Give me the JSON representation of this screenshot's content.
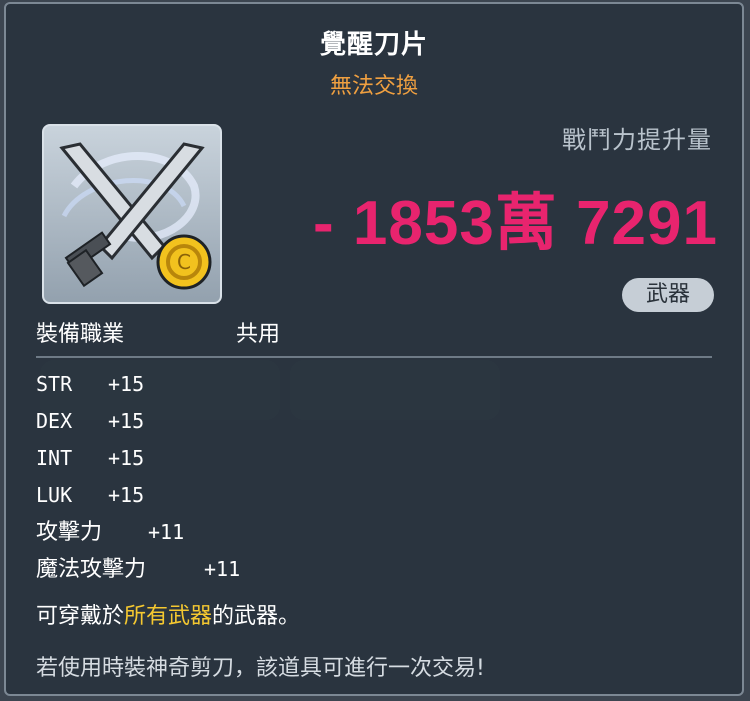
{
  "item": {
    "name": "覺醒刀片",
    "trade_status": "無法交換"
  },
  "combat_power": {
    "label": "戰鬥力提升量",
    "value": "- 1853萬 7291"
  },
  "category": "武器",
  "job": {
    "label": "裝備職業",
    "value": "共用"
  },
  "stats": [
    {
      "name": "STR",
      "value": "+15"
    },
    {
      "name": "DEX",
      "value": "+15"
    },
    {
      "name": "INT",
      "value": "+15"
    },
    {
      "name": "LUK",
      "value": "+15"
    },
    {
      "name": "攻擊力",
      "value": "+11"
    },
    {
      "name": "魔法攻擊力",
      "value": "+11"
    }
  ],
  "description": {
    "line1_prefix": "可穿戴於",
    "line1_highlight": "所有武器",
    "line1_suffix": "的武器。",
    "line2": "若使用時裝神奇剪刀，該道具可進行一次交易!"
  },
  "colors": {
    "title": "#ffffff",
    "trade_status": "#f0a040",
    "combat_power": "#e8246e",
    "highlight": "#f5c830"
  },
  "icons": {
    "item": "crossed-blades-with-gold-coin-icon"
  }
}
